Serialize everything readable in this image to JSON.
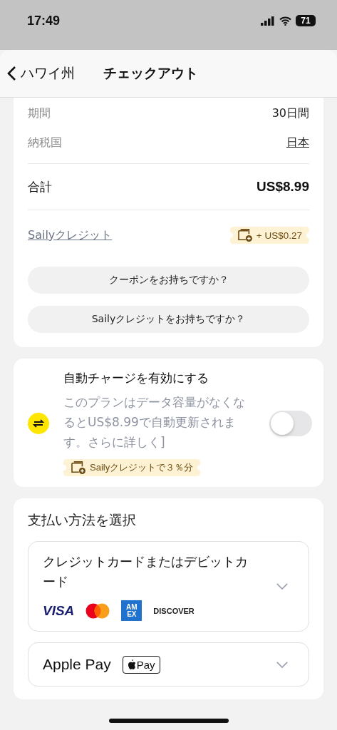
{
  "status_bar": {
    "time": "17:49",
    "battery": "71"
  },
  "header": {
    "back_label": "ハワイ州",
    "title": "チェックアウト"
  },
  "summary": {
    "rows": [
      {
        "label": "期間",
        "value": "30日間",
        "kind": "plain"
      },
      {
        "label": "納税国",
        "value": "日本",
        "kind": "link"
      }
    ],
    "total": {
      "label": "合計",
      "value": "US$8.99"
    },
    "credit": {
      "label": "Sailyクレジット",
      "badge": "+ US$0.27"
    },
    "buttons": [
      "クーポンをお持ちですか？",
      "Sailyクレジットをお持ちですか？"
    ]
  },
  "auto_charge": {
    "title": "自動チャージを有効にする",
    "description": "このプランはデータ容量がなくなるとUS$8.99で自動更新されます。さらに詳しく]",
    "on": false,
    "badge": "Sailyクレジットで３％分"
  },
  "payment": {
    "title": "支払い方法を選択",
    "methods": [
      {
        "kind": "cards",
        "label": "クレジットカードまたはデビットカード",
        "expanded": false,
        "logos": [
          {
            "kind": "visa",
            "label": "VISA"
          },
          {
            "kind": "mastercard"
          },
          {
            "kind": "amex",
            "label": "AM EX"
          },
          {
            "kind": "discover",
            "label": "DISCOVER"
          }
        ]
      },
      {
        "kind": "applepay",
        "label": "Apple Pay",
        "expanded": false,
        "badge": "Pay"
      }
    ]
  }
}
